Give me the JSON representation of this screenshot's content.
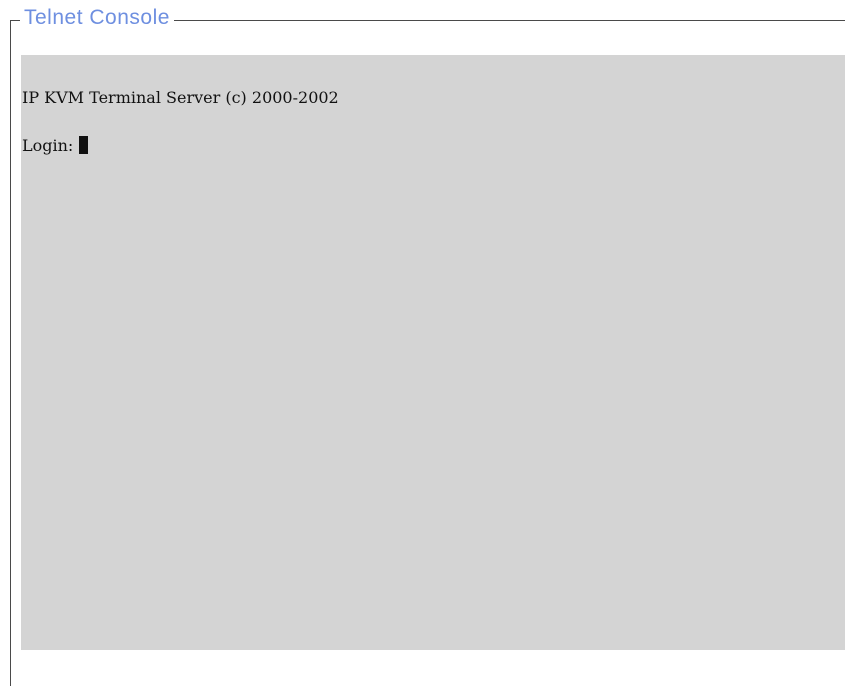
{
  "console": {
    "title": "Telnet Console",
    "lines": [
      "IP KVM Terminal Server (c) 2000-2002",
      "Login:"
    ],
    "background_color": "#d4d4d4",
    "title_color": "#6e8fe0"
  }
}
